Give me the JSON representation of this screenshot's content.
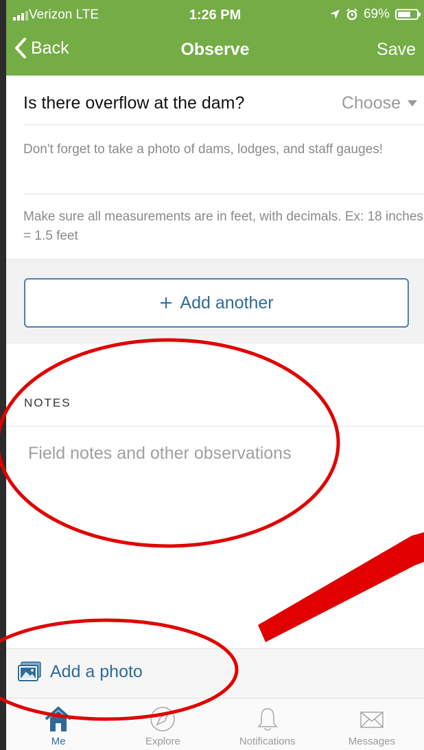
{
  "status_bar": {
    "carrier": "Verizon  LTE",
    "time": "1:26 PM",
    "battery": "69%",
    "battery_level": 0.69
  },
  "nav": {
    "back_label": "Back",
    "title": "Observe",
    "save_label": "Save"
  },
  "form": {
    "question": "Is there overflow at the dam?",
    "choose_label": "Choose",
    "hint1": "Don't forget to take a photo of dams, lodges, and staff gauges!",
    "hint2": "Make sure all measurements are in feet, with decimals. Ex: 18 inches = 1.5 feet",
    "add_another_label": "Add another"
  },
  "notes": {
    "label": "NOTES",
    "placeholder": "Field notes and other observations"
  },
  "photo": {
    "add_label": "Add a photo"
  },
  "tabs": [
    {
      "label": "Me",
      "icon": "home-icon",
      "active": true
    },
    {
      "label": "Explore",
      "icon": "compass-icon",
      "active": false
    },
    {
      "label": "Notifications",
      "icon": "bell-icon",
      "active": false
    },
    {
      "label": "Messages",
      "icon": "envelope-icon",
      "active": false
    }
  ],
  "colors": {
    "header_green": "#74ac45",
    "link_blue": "#2f6b9a",
    "annotation_red": "#e00000"
  }
}
